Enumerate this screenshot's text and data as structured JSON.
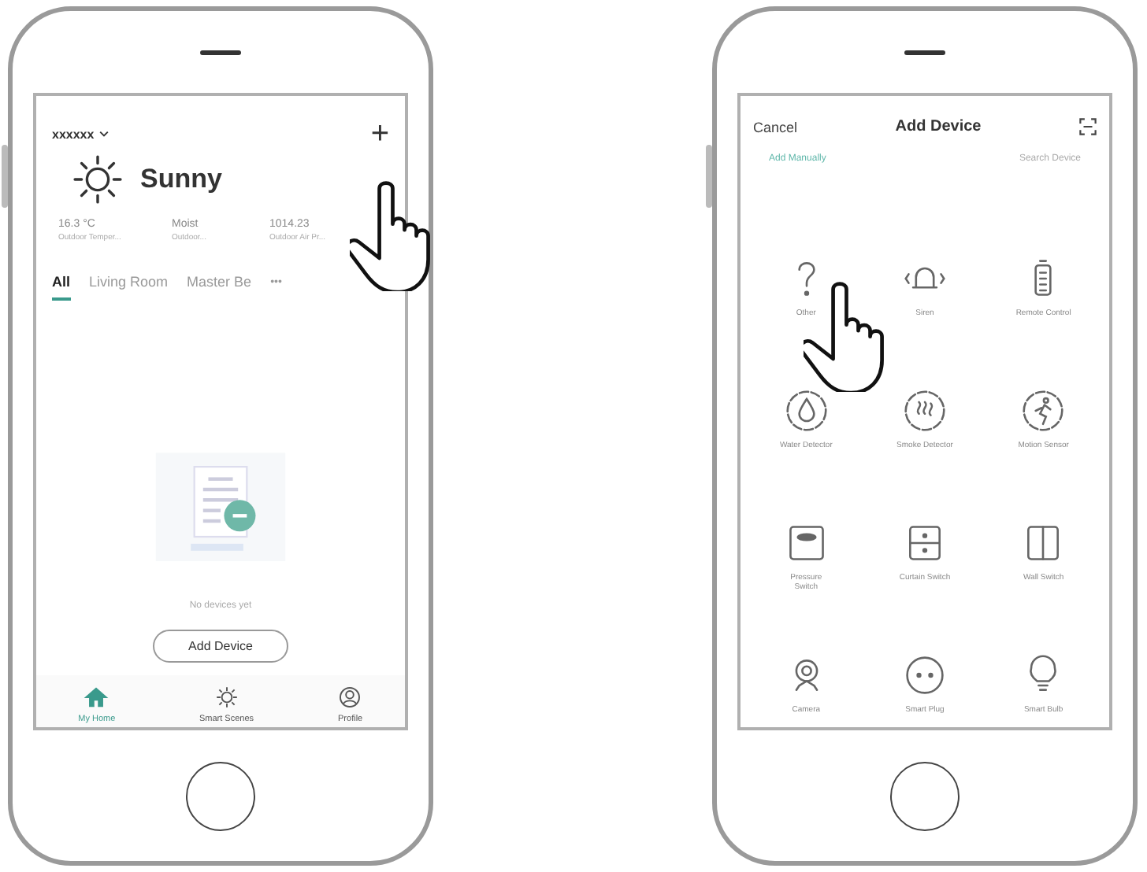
{
  "home_screen": {
    "home_name": "xxxxxx",
    "add_symbol": "+",
    "weather": {
      "condition": "Sunny",
      "stats": [
        {
          "value": "16.3 °C",
          "label": "Outdoor Temper..."
        },
        {
          "value": "Moist",
          "label": "Outdoor..."
        },
        {
          "value": "1014.23",
          "label": "Outdoor Air Pr..."
        }
      ]
    },
    "room_tabs": [
      {
        "label": "All",
        "selected": true
      },
      {
        "label": "Living Room",
        "selected": false
      },
      {
        "label": "Master Be",
        "selected": false
      }
    ],
    "more_symbol": "•••",
    "empty_message": "No devices yet",
    "add_button": "Add Device",
    "nav": [
      {
        "kind": "home",
        "label": "My Home",
        "selected": true
      },
      {
        "kind": "scenes",
        "label": "Smart Scenes",
        "selected": false
      },
      {
        "kind": "profile",
        "label": "Profile",
        "selected": false
      }
    ]
  },
  "add_device_screen": {
    "cancel": "Cancel",
    "title": "Add Device",
    "tabs": [
      {
        "label": "Add Manually",
        "selected": true
      },
      {
        "label": "Search Device",
        "selected": false
      }
    ],
    "devices": [
      {
        "kind": "other",
        "label": "Other"
      },
      {
        "kind": "siren",
        "label": "Siren"
      },
      {
        "kind": "remote",
        "label": "Remote Control"
      },
      {
        "kind": "water",
        "label": "Water Detector"
      },
      {
        "kind": "smoke",
        "label": "Smoke Detector"
      },
      {
        "kind": "motion",
        "label": "Motion Sensor"
      },
      {
        "kind": "pressure",
        "label": "Pressure Switch"
      },
      {
        "kind": "curtain",
        "label": "Curtain Switch"
      },
      {
        "kind": "wall",
        "label": "Wall Switch"
      },
      {
        "kind": "camera",
        "label": "Camera"
      },
      {
        "kind": "plug",
        "label": "Smart Plug"
      },
      {
        "kind": "bulb",
        "label": "Smart Bulb"
      }
    ]
  }
}
